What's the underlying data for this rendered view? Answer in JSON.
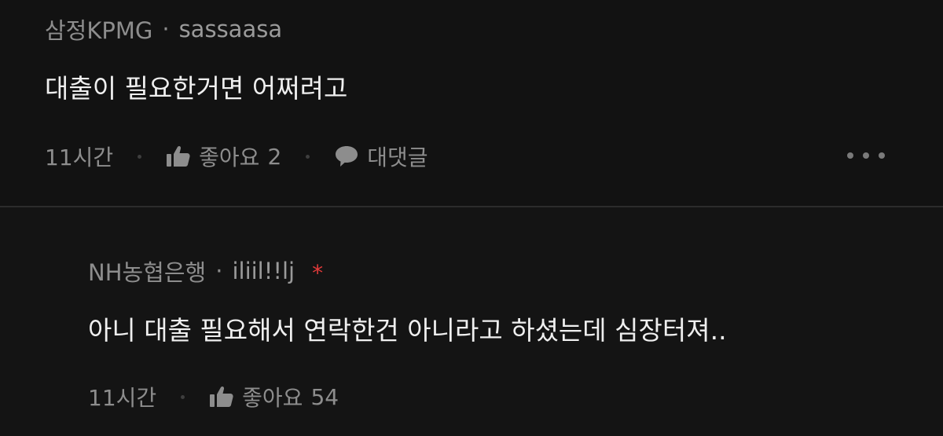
{
  "comments": [
    {
      "author": "삼정KPMG",
      "separator": "·",
      "nickname": "sassaasa",
      "text": "대출이 필요한거면 어쩌려고",
      "time": "11시간",
      "like_label": "좋아요",
      "like_count": "2",
      "reply_label": "대댓글"
    },
    {
      "author": "NH농협은행",
      "separator": "·",
      "nickname": "iliil!!lj",
      "badge": "*",
      "text": "아니 대출 필요해서 연락한건 아니라고 하셨는데 심장터져..",
      "time": "11시간",
      "like_label": "좋아요",
      "like_count": "54"
    }
  ],
  "colors": {
    "background": "#121212",
    "text": "#efefef",
    "muted": "#8d8d8d",
    "badge": "#e23a3a"
  },
  "icons": {
    "like": "thumbs-up-icon",
    "reply": "speech-bubble-icon",
    "more": "more-horizontal-icon"
  }
}
